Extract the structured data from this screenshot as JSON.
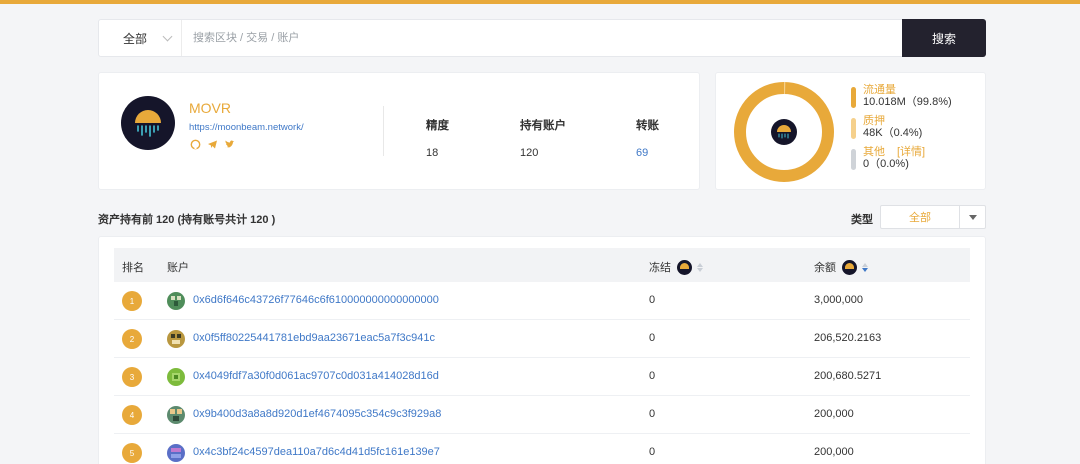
{
  "search": {
    "scope": "全部",
    "placeholder": "搜索区块 / 交易 / 账户",
    "button": "搜索"
  },
  "token": {
    "name": "MOVR",
    "url": "https://moonbeam.network/",
    "socials": [
      "github-icon",
      "telegram-icon",
      "twitter-icon"
    ],
    "stats": [
      {
        "label": "精度",
        "value": "18"
      },
      {
        "label": "持有账户",
        "value": "120"
      },
      {
        "label": "转账",
        "value": "69"
      }
    ]
  },
  "distribution": {
    "items": [
      {
        "name": "流通量",
        "value": "10.018M（99.8%)",
        "color": "#e8a93a",
        "fraction": 0.998
      },
      {
        "name": "质押",
        "value": "48K（0.4%)",
        "color": "#f5d08c",
        "fraction": 0.004
      },
      {
        "name": "其他",
        "detail": "[详情]",
        "value": "0（0.0%)",
        "color": "#cfd3d8",
        "fraction": 0.0
      }
    ]
  },
  "holders": {
    "title": "资产持有前 120 (持有账号共计 120 )",
    "type_label": "类型",
    "type_value": "全部",
    "columns": {
      "rank": "排名",
      "account": "账户",
      "frozen": "冻结",
      "balance": "余额"
    },
    "rows": [
      {
        "rank": "1",
        "address": "0x6d6f646c43726f77646c6f610000000000000000",
        "frozen": "0",
        "balance": "3,000,000",
        "avatar_color": "#4f8d5a"
      },
      {
        "rank": "2",
        "address": "0x0f5ff80225441781ebd9aa23671eac5a7f3c941c",
        "frozen": "0",
        "balance": "206,520.2163",
        "avatar_color": "#b9973f"
      },
      {
        "rank": "3",
        "address": "0x4049fdf7a30f0d061ac9707c0d031a414028d16d",
        "frozen": "0",
        "balance": "200,680.5271",
        "avatar_color": "#7dbb3c"
      },
      {
        "rank": "4",
        "address": "0x9b400d3a8a8d920d1ef4674095c354c9c3f929a8",
        "frozen": "0",
        "balance": "200,000",
        "avatar_color": "#5c8a6e"
      },
      {
        "rank": "5",
        "address": "0x4c3bf24c4597dea110a7d6c4d41d5fc161e139e7",
        "frozen": "0",
        "balance": "200,000",
        "avatar_color": "#5a6fc7"
      }
    ]
  }
}
